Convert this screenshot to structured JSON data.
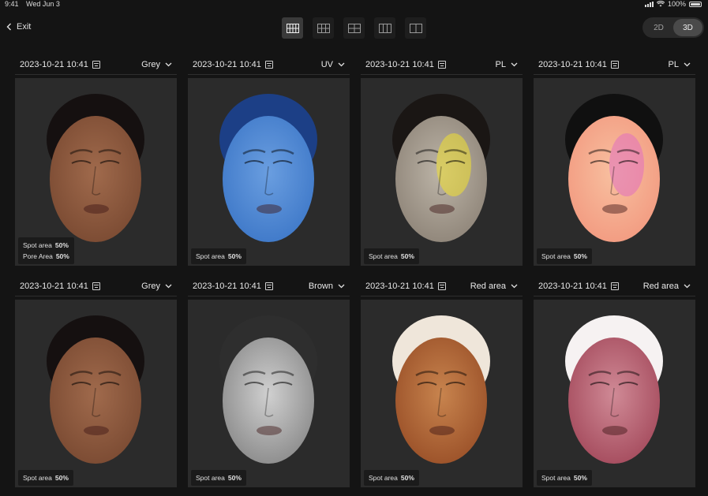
{
  "status_bar": {
    "time": "9:41",
    "date": "Wed Jun 3",
    "battery": "100%"
  },
  "toolbar": {
    "exit_label": "Exit",
    "layouts": [
      {
        "icon": "grid-4x2-icon",
        "active": true
      },
      {
        "icon": "grid-3x2-icon",
        "active": false
      },
      {
        "icon": "grid-2x2-icon",
        "active": false
      },
      {
        "icon": "grid-3-col-icon",
        "active": false
      },
      {
        "icon": "grid-2-col-icon",
        "active": false
      }
    ],
    "view_modes": [
      "2D",
      "3D"
    ],
    "active_view_mode": "3D"
  },
  "panels": [
    {
      "datetime": "2023-10-21 10:41",
      "mode": "Grey",
      "metrics": [
        {
          "label": "Spot area",
          "value": "50%"
        },
        {
          "label": "Pore Area",
          "value": "50%"
        }
      ],
      "skin": "#7a4a32",
      "skin_light": "#a06a4c",
      "hair": "#151010",
      "tint": ""
    },
    {
      "datetime": "2023-10-21 10:41",
      "mode": "UV",
      "metrics": [
        {
          "label": "Spot area",
          "value": "50%"
        }
      ],
      "skin": "#3e78c8",
      "skin_light": "#6a9ee0",
      "hair": "#1c3f86",
      "tint": ""
    },
    {
      "datetime": "2023-10-21 10:41",
      "mode": "PL",
      "metrics": [
        {
          "label": "Spot area",
          "value": "50%"
        }
      ],
      "skin": "#8e8478",
      "skin_light": "#bdb5a8",
      "hair": "#1a1614",
      "tint": "#f0e030"
    },
    {
      "datetime": "2023-10-21 10:41",
      "mode": "PL",
      "metrics": [
        {
          "label": "Spot area",
          "value": "50%"
        }
      ],
      "skin": "#f29a80",
      "skin_light": "#f8c0a0",
      "hair": "#101010",
      "tint": "#e070c0"
    },
    {
      "datetime": "2023-10-21 10:41",
      "mode": "Grey",
      "metrics": [
        {
          "label": "Spot area",
          "value": "50%"
        }
      ],
      "skin": "#7a4a32",
      "skin_light": "#a06a4c",
      "hair": "#151010",
      "tint": ""
    },
    {
      "datetime": "2023-10-21 10:41",
      "mode": "Brown",
      "metrics": [
        {
          "label": "Spot area",
          "value": "50%"
        }
      ],
      "skin": "#8a8a8a",
      "skin_light": "#d0d0d0",
      "hair": "#2e2e2e",
      "tint": ""
    },
    {
      "datetime": "2023-10-21 10:41",
      "mode": "Red area",
      "metrics": [
        {
          "label": "Spot area",
          "value": "50%"
        }
      ],
      "skin": "#9a5028",
      "skin_light": "#c8844e",
      "hair": "#efe6da",
      "tint": ""
    },
    {
      "datetime": "2023-10-21 10:41",
      "mode": "Red area",
      "metrics": [
        {
          "label": "Spot area",
          "value": "50%"
        }
      ],
      "skin": "#a44a5c",
      "skin_light": "#d08a96",
      "hair": "#f6f2f2",
      "tint": ""
    }
  ]
}
